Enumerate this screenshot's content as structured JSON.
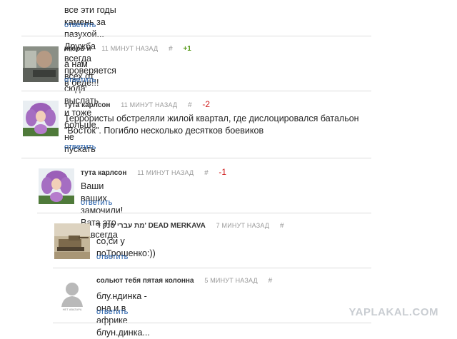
{
  "comments": [
    {
      "text_lines": [
        "все эти годы камень за пазухой... Дружба всегда проверяется в беде!!!"
      ],
      "reply": "ответить"
    },
    {
      "author": "игорь и",
      "time": "11 минут назад",
      "hash": "#",
      "score": "+1",
      "text_lines": [
        "а нам всех от сюда выслать и тоже больше не пускать"
      ],
      "reply": "ответить"
    },
    {
      "author": "тута карлсон",
      "time": "11 минут назад",
      "hash": "#",
      "score": "-2",
      "text_lines": [
        "Террористы обстреляли жилой квартал, где дислоцировался батальон",
        "\"Восток\". Погибло несколько десятков боевиков"
      ],
      "reply": "ответить"
    },
    {
      "author": "тута карлсон",
      "time": "11 минут назад",
      "hash": "#",
      "score": "-1",
      "text_lines": [
        "Ваши ваших замочили! Вата это навсегда"
      ],
      "reply": "ответить"
    },
    {
      "author": "מת עברי טנק ד' DEAD MERKAVA",
      "time": "7 минут назад",
      "hash": "#",
      "text_lines": [
        "со,си у поТрошенко:))"
      ],
      "reply": "ответить"
    },
    {
      "author": "сольют тебя пятая колонна",
      "time": "5 минут назад",
      "hash": "#",
      "avatar_caption": "нет аватара",
      "text_lines": [
        "блу.ндинка - она и в африке блун.динка..."
      ],
      "reply": "ответить"
    }
  ],
  "site_logo": "YAPLAKAL.COM"
}
